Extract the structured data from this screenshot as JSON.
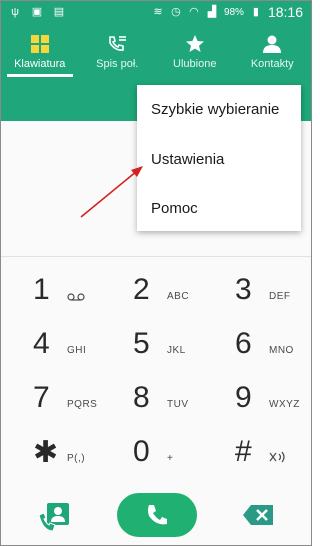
{
  "statusbar": {
    "battery": "98%",
    "time": "18:16"
  },
  "tabs": [
    {
      "label": "Klawiatura",
      "icon": "keypad-icon",
      "active": true
    },
    {
      "label": "Spis poł.",
      "icon": "call-log-icon",
      "active": false
    },
    {
      "label": "Ulubione",
      "icon": "star-icon",
      "active": false
    },
    {
      "label": "Kontakty",
      "icon": "person-icon",
      "active": false
    }
  ],
  "menu": {
    "items": [
      "Szybkie wybieranie",
      "Ustawienia",
      "Pomoc"
    ]
  },
  "keypad": {
    "rows": [
      [
        {
          "digit": "1",
          "letters": ""
        },
        {
          "digit": "2",
          "letters": "ABC"
        },
        {
          "digit": "3",
          "letters": "DEF"
        }
      ],
      [
        {
          "digit": "4",
          "letters": "GHI"
        },
        {
          "digit": "5",
          "letters": "JKL"
        },
        {
          "digit": "6",
          "letters": "MNO"
        }
      ],
      [
        {
          "digit": "7",
          "letters": "PQRS"
        },
        {
          "digit": "8",
          "letters": "TUV"
        },
        {
          "digit": "9",
          "letters": "WXYZ"
        }
      ],
      [
        {
          "digit": "✱",
          "letters": "P(,)"
        },
        {
          "digit": "0",
          "letters": "+"
        },
        {
          "digit": "#",
          "letters": ""
        }
      ]
    ]
  },
  "colors": {
    "accent": "#1fa67a",
    "call": "#1fb072",
    "annotation_arrow": "#d42020"
  }
}
